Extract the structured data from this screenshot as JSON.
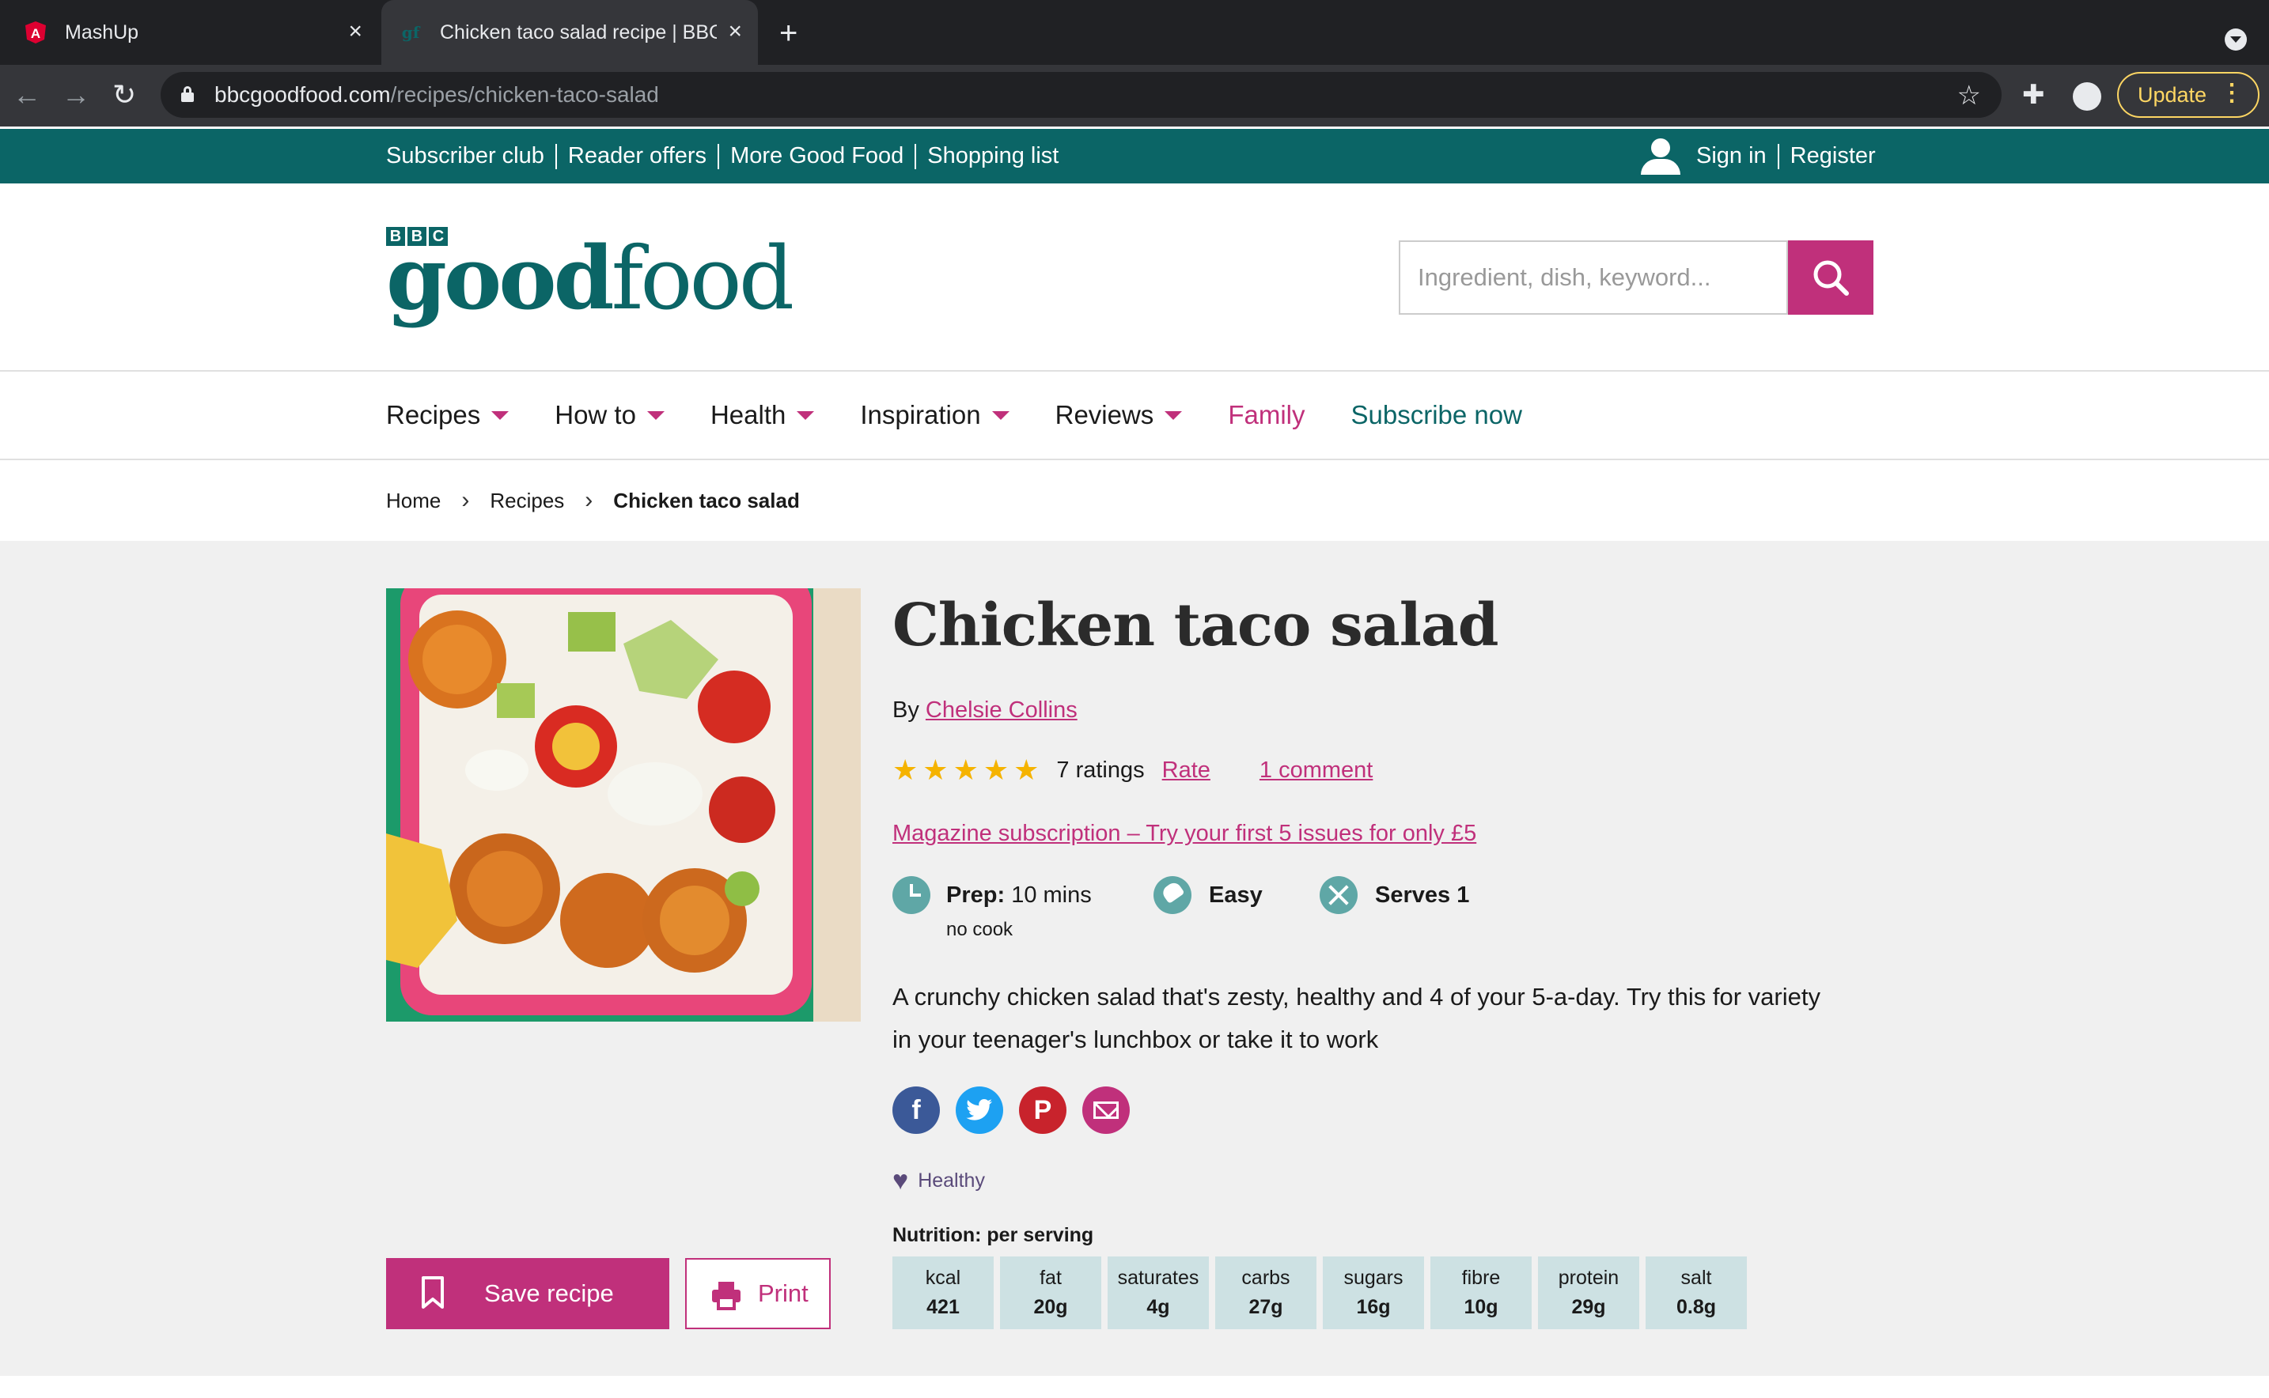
{
  "browser": {
    "tabs": [
      {
        "title": "MashUp",
        "favicon": "angular-icon",
        "active": false
      },
      {
        "title": "Chicken taco salad recipe | BBC",
        "favicon": "goodfood-icon",
        "active": true
      }
    ],
    "url_host": "bbcgoodfood.com",
    "url_path": "/recipes/chicken-taco-salad",
    "update_label": "Update"
  },
  "topbar": {
    "links": [
      "Subscriber club",
      "Reader offers",
      "More Good Food",
      "Shopping list"
    ],
    "sign_in": "Sign in",
    "register": "Register"
  },
  "header": {
    "logo_bbc": [
      "B",
      "B",
      "C"
    ],
    "logo_good": "good",
    "logo_food": "food",
    "search_placeholder": "Ingredient, dish, keyword..."
  },
  "nav": {
    "items": [
      {
        "label": "Recipes",
        "dropdown": true
      },
      {
        "label": "How to",
        "dropdown": true
      },
      {
        "label": "Health",
        "dropdown": true
      },
      {
        "label": "Inspiration",
        "dropdown": true
      },
      {
        "label": "Reviews",
        "dropdown": true
      },
      {
        "label": "Family",
        "dropdown": false
      },
      {
        "label": "Subscribe now",
        "dropdown": false
      }
    ]
  },
  "breadcrumb": [
    "Home",
    "Recipes",
    "Chicken taco salad"
  ],
  "recipe": {
    "title": "Chicken taco salad",
    "by": "By",
    "author": "Chelsie Collins",
    "rating_stars": 5,
    "ratings_count": "7 ratings",
    "rate_label": "Rate",
    "comments": "1 comment",
    "promo": "Magazine subscription – Try your first 5 issues for only £5",
    "prep_label": "Prep:",
    "prep_value": "10 mins",
    "prep_note": "no cook",
    "skill": "Easy",
    "serves": "Serves 1",
    "description": "A crunchy chicken salad that's zesty, healthy and 4 of your 5-a-day. Try this for variety in your teenager's lunchbox or take it to work",
    "tag": "Healthy",
    "save_label": "Save recipe",
    "print_label": "Print",
    "nutrition_title": "Nutrition: per serving",
    "nutrition": [
      {
        "label": "kcal",
        "value": "421"
      },
      {
        "label": "fat",
        "value": "20g"
      },
      {
        "label": "saturates",
        "value": "4g"
      },
      {
        "label": "carbs",
        "value": "27g"
      },
      {
        "label": "sugars",
        "value": "16g"
      },
      {
        "label": "fibre",
        "value": "10g"
      },
      {
        "label": "protein",
        "value": "29g"
      },
      {
        "label": "salt",
        "value": "0.8g"
      }
    ]
  },
  "colors": {
    "brand_teal": "#0b6566",
    "accent_magenta": "#c0307b",
    "nutrition_bg": "#cde1e3",
    "star": "#f5b300"
  }
}
